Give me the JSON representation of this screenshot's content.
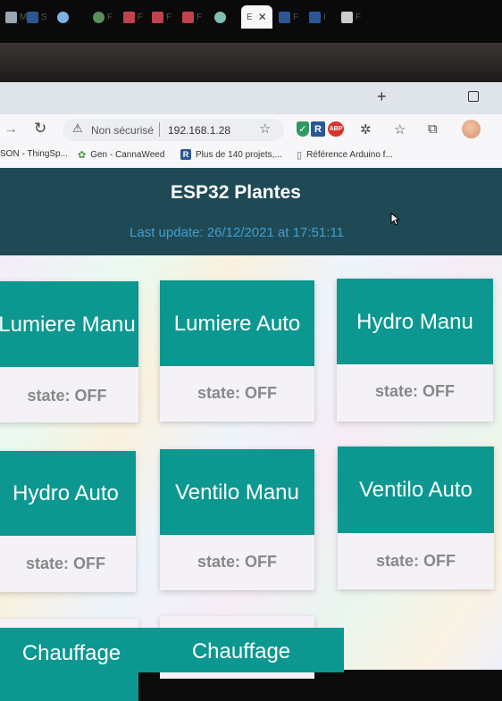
{
  "browser": {
    "tabs": [
      {
        "label": "M"
      },
      {
        "label": "S"
      },
      {
        "label": "F"
      },
      {
        "label": "F"
      },
      {
        "label": "F"
      },
      {
        "label": "F"
      },
      {
        "label": "E"
      },
      {
        "label": "F"
      },
      {
        "label": "I"
      },
      {
        "label": "F"
      }
    ],
    "active_tab_label": "E",
    "security_label": "Non sécurisé",
    "url": "192.168.1.28",
    "bookmarks": [
      {
        "label": "SON - ThingSp..."
      },
      {
        "label": "Gen - CannaWeed"
      },
      {
        "label": "Plus de 140 projets,..."
      },
      {
        "label": "Référence Arduino f..."
      }
    ],
    "extensions": {
      "abp_label": "ABP",
      "r_label": "R"
    }
  },
  "page": {
    "title": "ESP32 Plantes",
    "last_update": "Last update: 26/12/2021 at 17:51:11"
  },
  "cards": [
    {
      "title": "Lumiere Manu",
      "state": "state: OFF"
    },
    {
      "title": "Lumiere Auto",
      "state": "state: OFF"
    },
    {
      "title": "Hydro Manu",
      "state": "state: OFF"
    },
    {
      "title": "Hydro Auto",
      "state": "state: OFF"
    },
    {
      "title": "Ventilo Manu",
      "state": "state: OFF"
    },
    {
      "title": "Ventilo Auto",
      "state": "state: OFF"
    },
    {
      "title": "Chauffage",
      "state": ""
    },
    {
      "title": "Chauffage",
      "state": ""
    }
  ],
  "colors": {
    "header_bg": "#1f4a55",
    "card_head": "#0c9890",
    "update_text": "#3f9fd0"
  }
}
